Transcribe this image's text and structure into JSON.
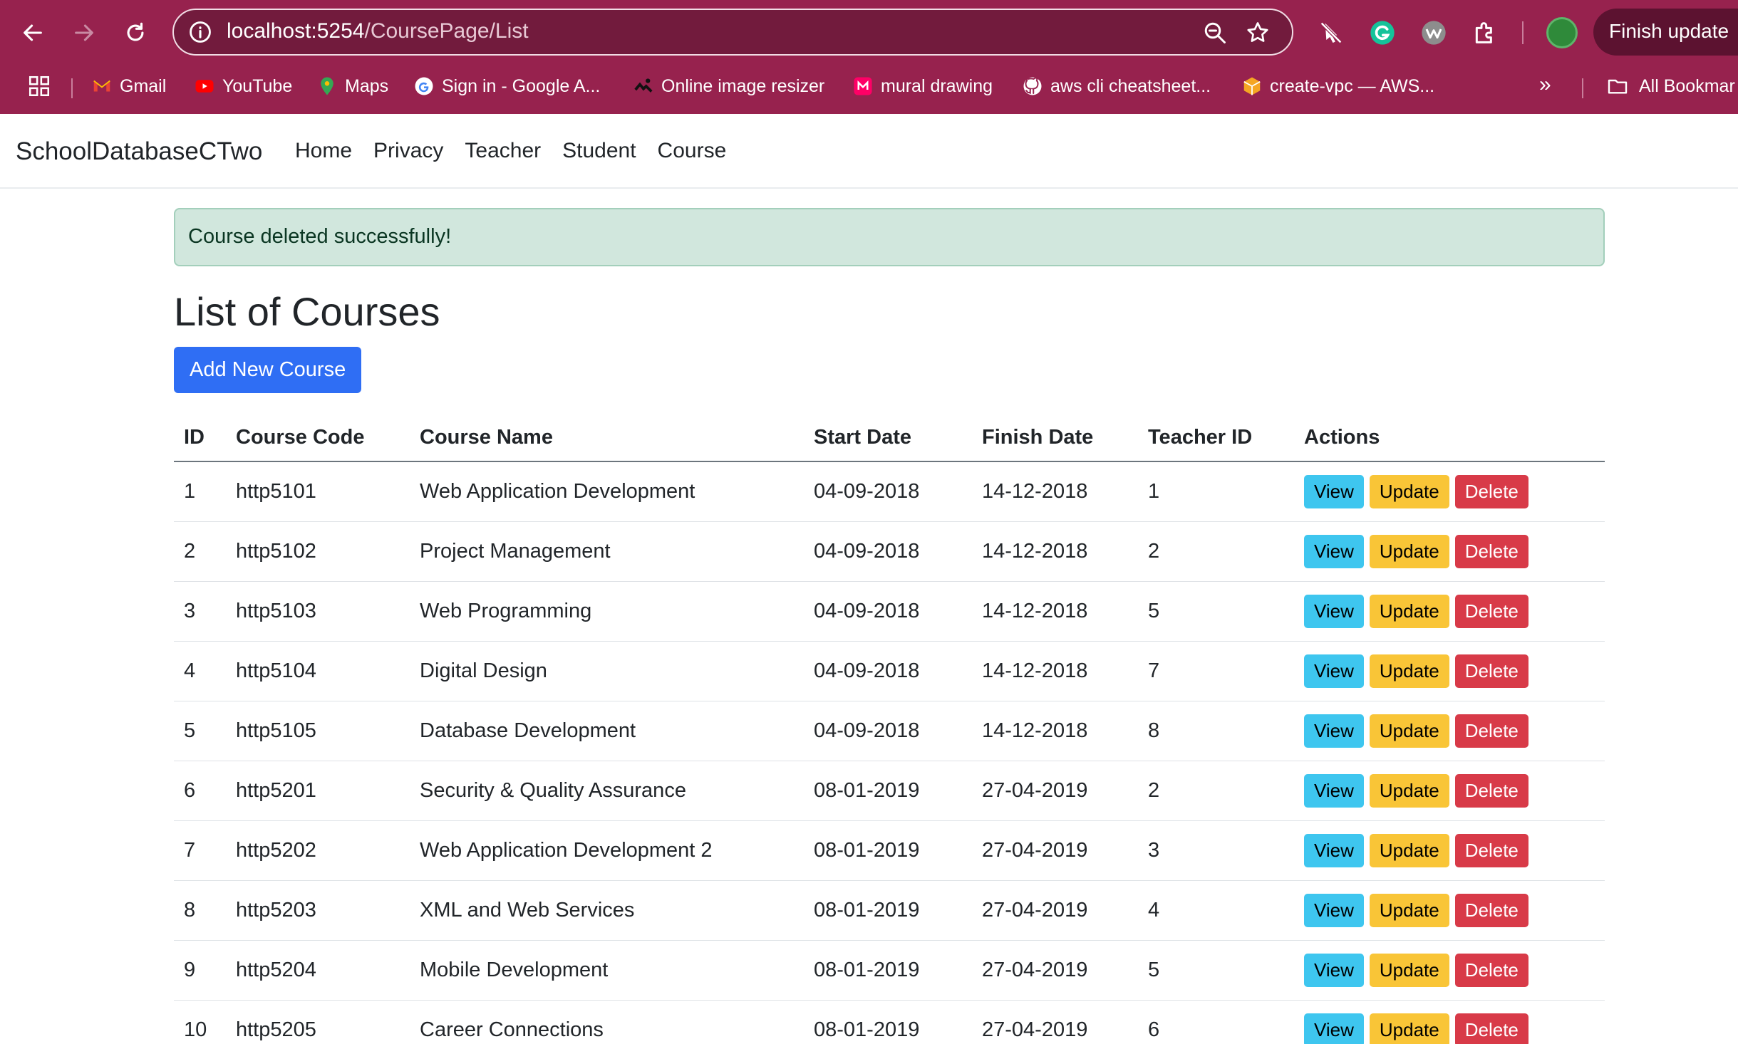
{
  "browser": {
    "url_host": "localhost:5254",
    "url_path": "/CoursePage/List",
    "finish_update_label": "Finish update",
    "bookmarks": [
      {
        "label": "Gmail",
        "icon": "gmail-icon"
      },
      {
        "label": "YouTube",
        "icon": "youtube-icon"
      },
      {
        "label": "Maps",
        "icon": "maps-icon"
      },
      {
        "label": "Sign in - Google A...",
        "icon": "google-icon"
      },
      {
        "label": "Online image resizer",
        "icon": "resizer-icon"
      },
      {
        "label": "mural drawing",
        "icon": "mural-icon"
      },
      {
        "label": "aws cli cheatsheet...",
        "icon": "github-icon"
      },
      {
        "label": "create-vpc — AWS...",
        "icon": "aws-icon"
      }
    ],
    "more_bookmarks": "»",
    "all_bookmarks_label": "All Bookmar",
    "colors": {
      "chrome": "#97224e",
      "omnibox": "#721b3d"
    }
  },
  "app": {
    "brand": "SchoolDatabaseCTwo",
    "nav": [
      "Home",
      "Privacy",
      "Teacher",
      "Student",
      "Course"
    ]
  },
  "alert": {
    "message": "Course deleted successfully!"
  },
  "page": {
    "title": "List of Courses",
    "add_button": "Add New Course"
  },
  "table": {
    "headers": [
      "ID",
      "Course Code",
      "Course Name",
      "Start Date",
      "Finish Date",
      "Teacher ID",
      "Actions"
    ],
    "action_labels": {
      "view": "View",
      "update": "Update",
      "delete": "Delete"
    },
    "rows": [
      {
        "id": "1",
        "code": "http5101",
        "name": "Web Application Development",
        "start": "04-09-2018",
        "finish": "14-12-2018",
        "teacher": "1"
      },
      {
        "id": "2",
        "code": "http5102",
        "name": "Project Management",
        "start": "04-09-2018",
        "finish": "14-12-2018",
        "teacher": "2"
      },
      {
        "id": "3",
        "code": "http5103",
        "name": "Web Programming",
        "start": "04-09-2018",
        "finish": "14-12-2018",
        "teacher": "5"
      },
      {
        "id": "4",
        "code": "http5104",
        "name": "Digital Design",
        "start": "04-09-2018",
        "finish": "14-12-2018",
        "teacher": "7"
      },
      {
        "id": "5",
        "code": "http5105",
        "name": "Database Development",
        "start": "04-09-2018",
        "finish": "14-12-2018",
        "teacher": "8"
      },
      {
        "id": "6",
        "code": "http5201",
        "name": "Security & Quality Assurance",
        "start": "08-01-2019",
        "finish": "27-04-2019",
        "teacher": "2"
      },
      {
        "id": "7",
        "code": "http5202",
        "name": "Web Application Development 2",
        "start": "08-01-2019",
        "finish": "27-04-2019",
        "teacher": "3"
      },
      {
        "id": "8",
        "code": "http5203",
        "name": "XML and Web Services",
        "start": "08-01-2019",
        "finish": "27-04-2019",
        "teacher": "4"
      },
      {
        "id": "9",
        "code": "http5204",
        "name": "Mobile Development",
        "start": "08-01-2019",
        "finish": "27-04-2019",
        "teacher": "5"
      },
      {
        "id": "10",
        "code": "http5205",
        "name": "Career Connections",
        "start": "08-01-2019",
        "finish": "27-04-2019",
        "teacher": "6"
      }
    ]
  }
}
